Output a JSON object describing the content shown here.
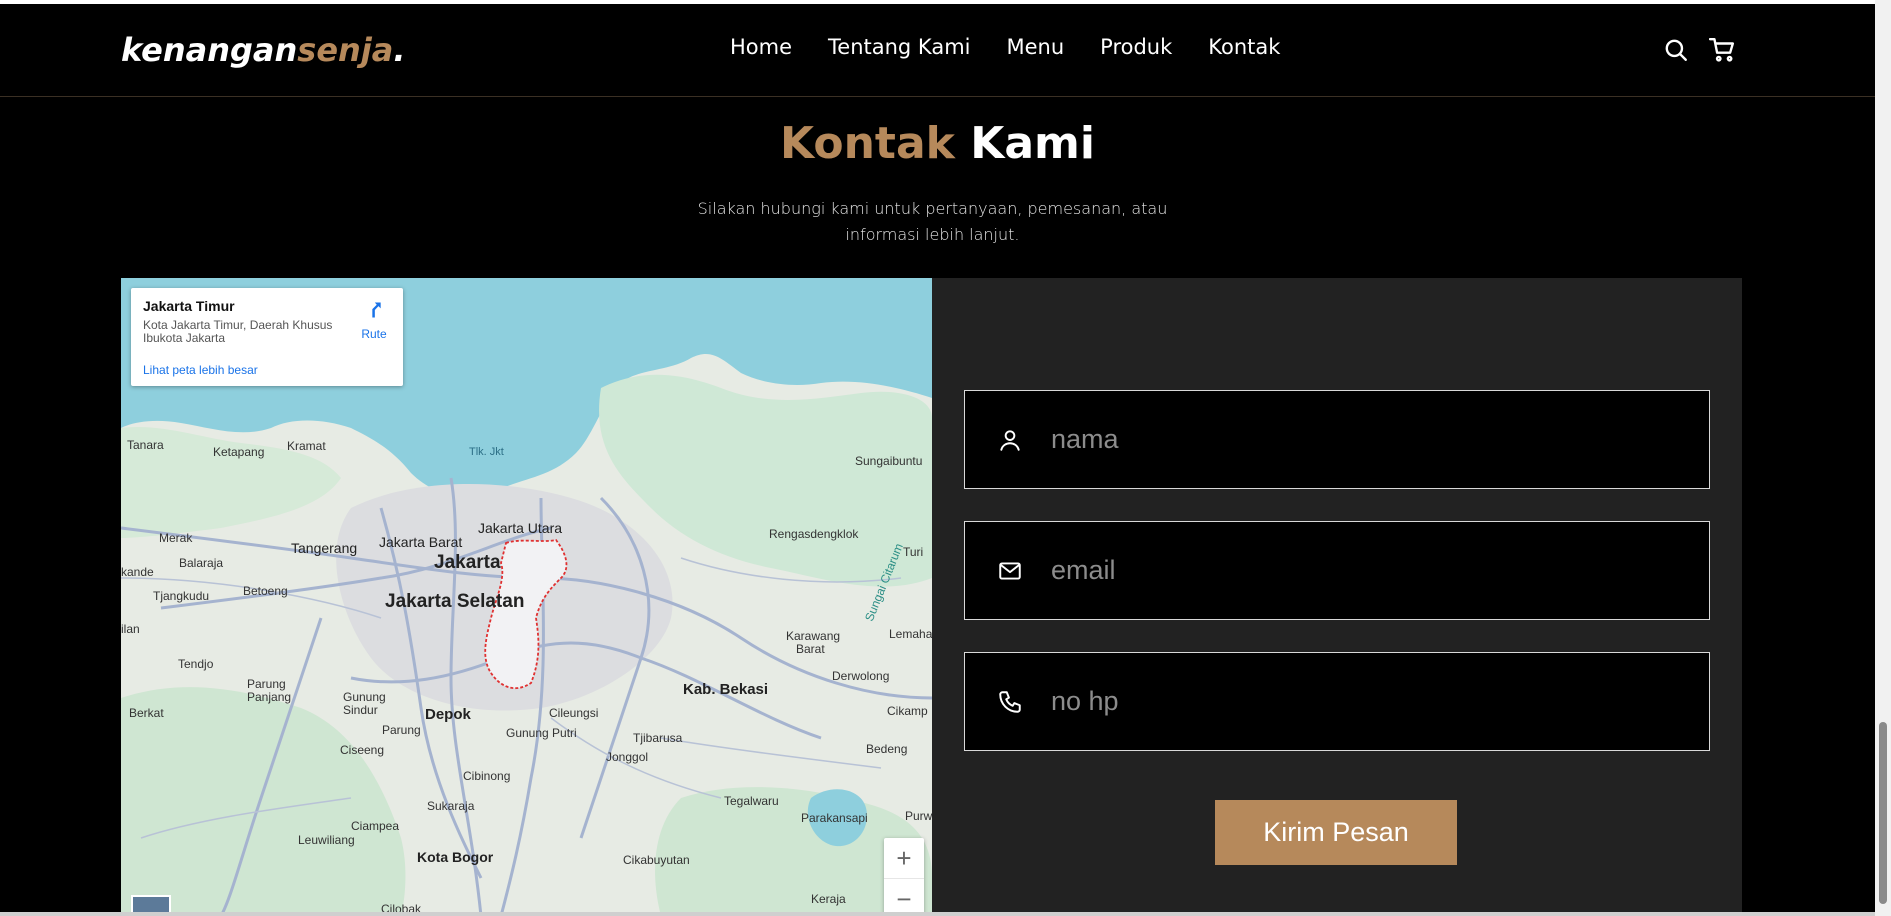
{
  "nav": {
    "logo_part1": "kenangan",
    "logo_part2": "senja",
    "logo_part3": ".",
    "links": [
      "Home",
      "Tentang Kami",
      "Menu",
      "Produk",
      "Kontak"
    ],
    "icons": [
      "search-icon",
      "cart-icon"
    ]
  },
  "section": {
    "title_part1": "Kontak",
    "title_part2": "Kami",
    "subtitle": "Silakan hubungi kami untuk pertanyaan, pemesanan, atau informasi lebih lanjut."
  },
  "map": {
    "card_title": "Jakarta Timur",
    "card_address": "Kota Jakarta Timur, Daerah Khusus Ibukota Jakarta",
    "card_link": "Lihat peta lebih besar",
    "route_label": "Rute",
    "zoom_in": "+",
    "zoom_out": "−",
    "labels": {
      "tanara": "Tanara",
      "ketapang": "Ketapang",
      "kramat": "Kramat",
      "tlk": "Tlk. Jkt",
      "sungaibuntu": "Sungaibuntu",
      "merak": "Merak",
      "tangerang": "Tangerang",
      "jakbar": "Jakarta Barat",
      "jakut": "Jakarta Utara",
      "jakarta": "Jakarta",
      "rengas": "Rengasdengklok",
      "turi": "Turi",
      "kande": "kande",
      "balaraja": "Balaraja",
      "tjangkudu": "Tjangkudu",
      "betoeng": "Betoeng",
      "jaksel": "Jakarta Selatan",
      "citarum": "Sungai Citarum",
      "karawang": "Karawang",
      "barat": "Barat",
      "lemaha": "Lemaha",
      "ilan": "ilan",
      "tendjo": "Tendjo",
      "derwolong": "Derwolong",
      "parung_panjang": "Parung Panjang",
      "gunung_sindur": "Gunung Sindur",
      "kab_bekasi": "Kab. Bekasi",
      "berkat": "Berkat",
      "depok": "Depok",
      "cileungsi": "Cileungsi",
      "cikamp": "Cikamp",
      "parung": "Parung",
      "gunung_putri": "Gunung Putri",
      "tjibarusa": "Tjibarusa",
      "ciseeng": "Ciseeng",
      "bedeng": "Bedeng",
      "jonggol": "Jonggol",
      "cibinong": "Cibinong",
      "sukaraja": "Sukaraja",
      "tegalwaru": "Tegalwaru",
      "ciampea": "Ciampea",
      "parakansapi": "Parakansapi",
      "purwak": "Purwak",
      "leuwiliang": "Leuwiliang",
      "kota_bogor": "Kota Bogor",
      "cikabuyutan": "Cikabuyutan",
      "keraja": "Keraja",
      "cilobak": "Cilobak"
    }
  },
  "form": {
    "name_placeholder": "nama",
    "email_placeholder": "email",
    "phone_placeholder": "no hp",
    "submit_label": "Kirim Pesan"
  },
  "colors": {
    "accent": "#b6895b",
    "panel": "#222222",
    "background": "#000000"
  }
}
